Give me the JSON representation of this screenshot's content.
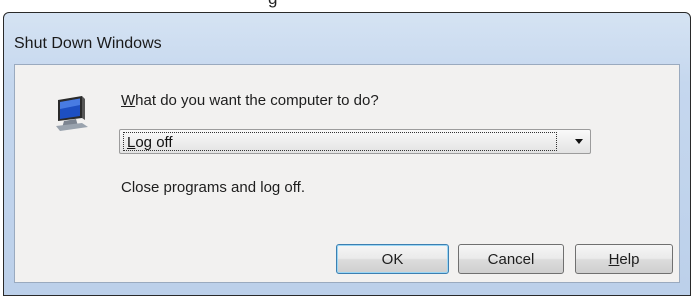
{
  "top_clip": {
    "text": "g"
  },
  "dialog": {
    "title": "Shut Down Windows",
    "question": {
      "access_key": "W",
      "rest": "hat do you want the computer to do?"
    },
    "action_select": {
      "access_key": "L",
      "rest": "og off",
      "icon": "chevron-down-icon"
    },
    "description": "Close programs and log off.",
    "buttons": {
      "ok": "OK",
      "cancel": "Cancel",
      "help": {
        "access_key": "H",
        "rest": "elp"
      }
    },
    "icon": "monitor-icon"
  },
  "colors": {
    "frame": "#c5d7ee",
    "client": "#f2f1f0",
    "default_button_border": "#3c7fb1"
  }
}
